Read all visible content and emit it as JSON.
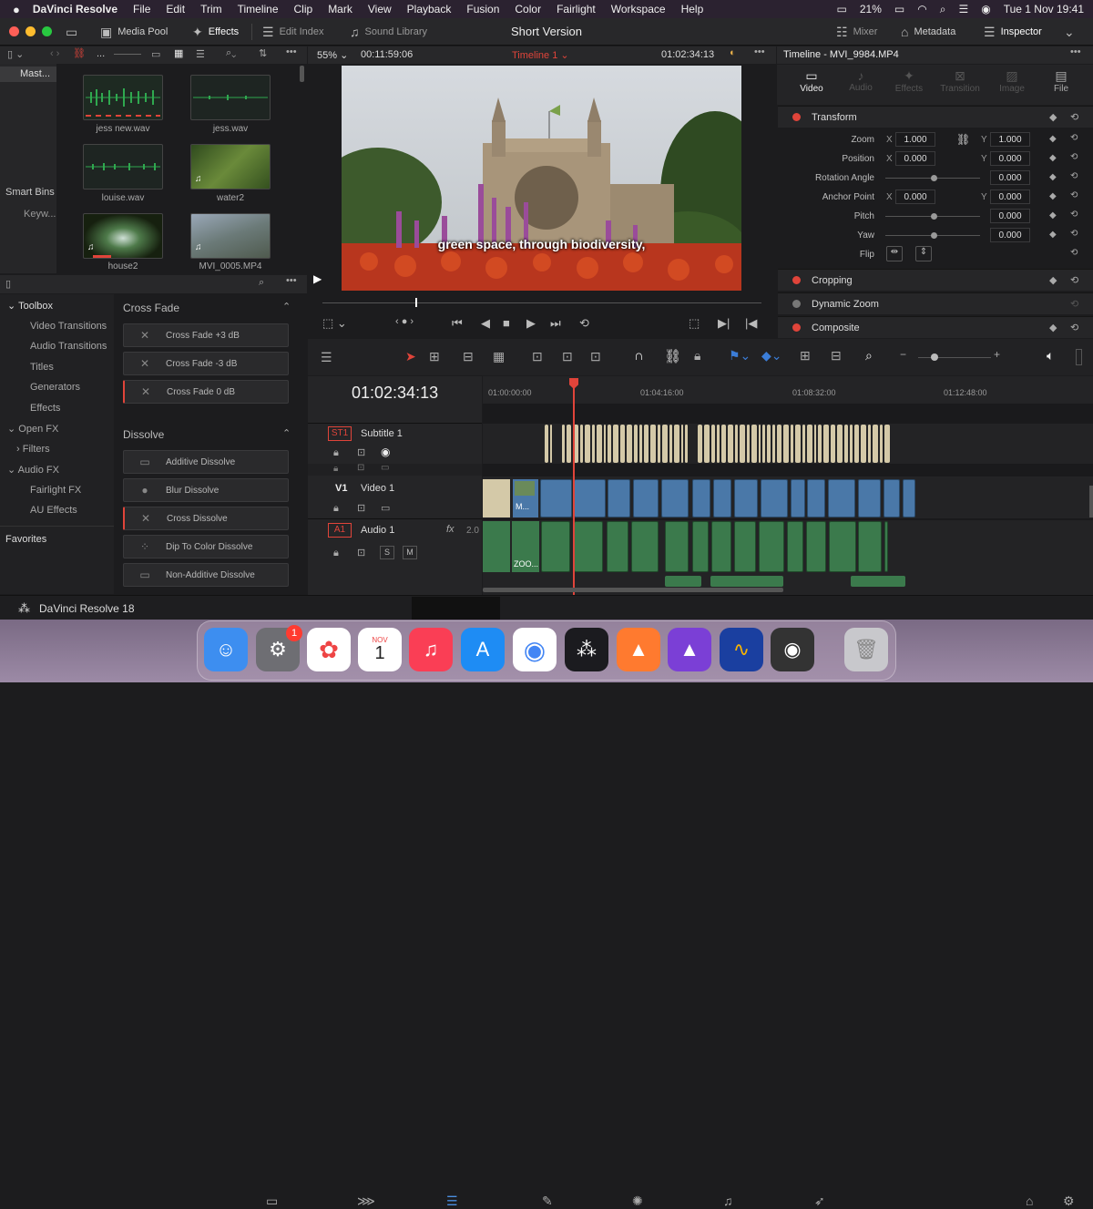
{
  "menubar": {
    "apple": "",
    "app": "DaVinci Resolve",
    "items": [
      "File",
      "Edit",
      "Trim",
      "Timeline",
      "Clip",
      "Mark",
      "View",
      "Playback",
      "Fusion",
      "Color",
      "Fairlight",
      "Workspace",
      "Help"
    ],
    "battery": "21%",
    "clock": "Tue 1 Nov  19:41"
  },
  "toolbar": {
    "media_pool": "Media Pool",
    "effects": "Effects",
    "edit_index": "Edit Index",
    "sound_library": "Sound Library",
    "project_title": "Short Version",
    "mixer": "Mixer",
    "metadata": "Metadata",
    "inspector": "Inspector"
  },
  "mediapool": {
    "view_menu": "...",
    "bin": "Mast...",
    "smart_bins": "Smart Bins",
    "keywords": "Keyw...",
    "clips": [
      {
        "name": "jess new.wav"
      },
      {
        "name": "jess.wav"
      },
      {
        "name": "louise.wav"
      },
      {
        "name": "water2"
      },
      {
        "name": "house2"
      },
      {
        "name": "MVI_0005.MP4"
      }
    ]
  },
  "viewer": {
    "zoom": "55%",
    "duration": "00:11:59:06",
    "timeline_name": "Timeline 1",
    "timecode": "01:02:34:13",
    "subtitle": "green space, through biodiversity,"
  },
  "toolbox": {
    "title": "Toolbox",
    "items": [
      "Video Transitions",
      "Audio Transitions",
      "Titles",
      "Generators",
      "Effects"
    ],
    "openfx": "Open FX",
    "filters": "Filters",
    "audiofx": "Audio FX",
    "fairlight": "Fairlight FX",
    "au": "AU Effects",
    "favorites": "Favorites"
  },
  "effects": {
    "crossfade_header": "Cross Fade",
    "crossfade": [
      "Cross Fade +3 dB",
      "Cross Fade -3 dB",
      "Cross Fade 0 dB"
    ],
    "dissolve_header": "Dissolve",
    "dissolve": [
      "Additive Dissolve",
      "Blur Dissolve",
      "Cross Dissolve",
      "Dip To Color Dissolve",
      "Non-Additive Dissolve"
    ]
  },
  "inspector": {
    "title": "Timeline - MVI_9984.MP4",
    "tabs": [
      "Video",
      "Audio",
      "Effects",
      "Transition",
      "Image",
      "File"
    ],
    "transform": "Transform",
    "zoom_label": "Zoom",
    "zoom_x": "1.000",
    "zoom_y": "1.000",
    "position_label": "Position",
    "pos_x": "0.000",
    "pos_y": "0.000",
    "rotation_label": "Rotation Angle",
    "rotation": "0.000",
    "anchor_label": "Anchor Point",
    "anchor_x": "0.000",
    "anchor_y": "0.000",
    "pitch_label": "Pitch",
    "pitch": "0.000",
    "yaw_label": "Yaw",
    "yaw": "0.000",
    "flip_label": "Flip",
    "x": "X",
    "y": "Y",
    "cropping": "Cropping",
    "dynamic_zoom": "Dynamic Zoom",
    "composite": "Composite"
  },
  "timeline": {
    "timecode": "01:02:34:13",
    "ruler": [
      "01:00:00:00",
      "01:04:16:00",
      "01:08:32:00",
      "01:12:48:00"
    ],
    "tracks": {
      "st1": "ST1",
      "st1_name": "Subtitle 1",
      "v1": "V1",
      "v1_name": "Video 1",
      "a1": "A1",
      "a1_name": "Audio 1",
      "a1_fx": "fx",
      "a1_level": "2.0",
      "solo": "S",
      "mute": "M"
    },
    "clip_m": "M...",
    "clip_zoo": "ZOO..."
  },
  "footer": {
    "app": "DaVinci Resolve 18"
  },
  "dock": {
    "badge": "1",
    "cal_month": "NOV",
    "cal_day": "1"
  },
  "colors": {
    "accent_red": "#e0443a",
    "video_clip": "#4a78a8",
    "audio_clip": "#3b7a4c",
    "subtitle_clip": "#d4c9a8",
    "playhead": "#e0443a"
  }
}
